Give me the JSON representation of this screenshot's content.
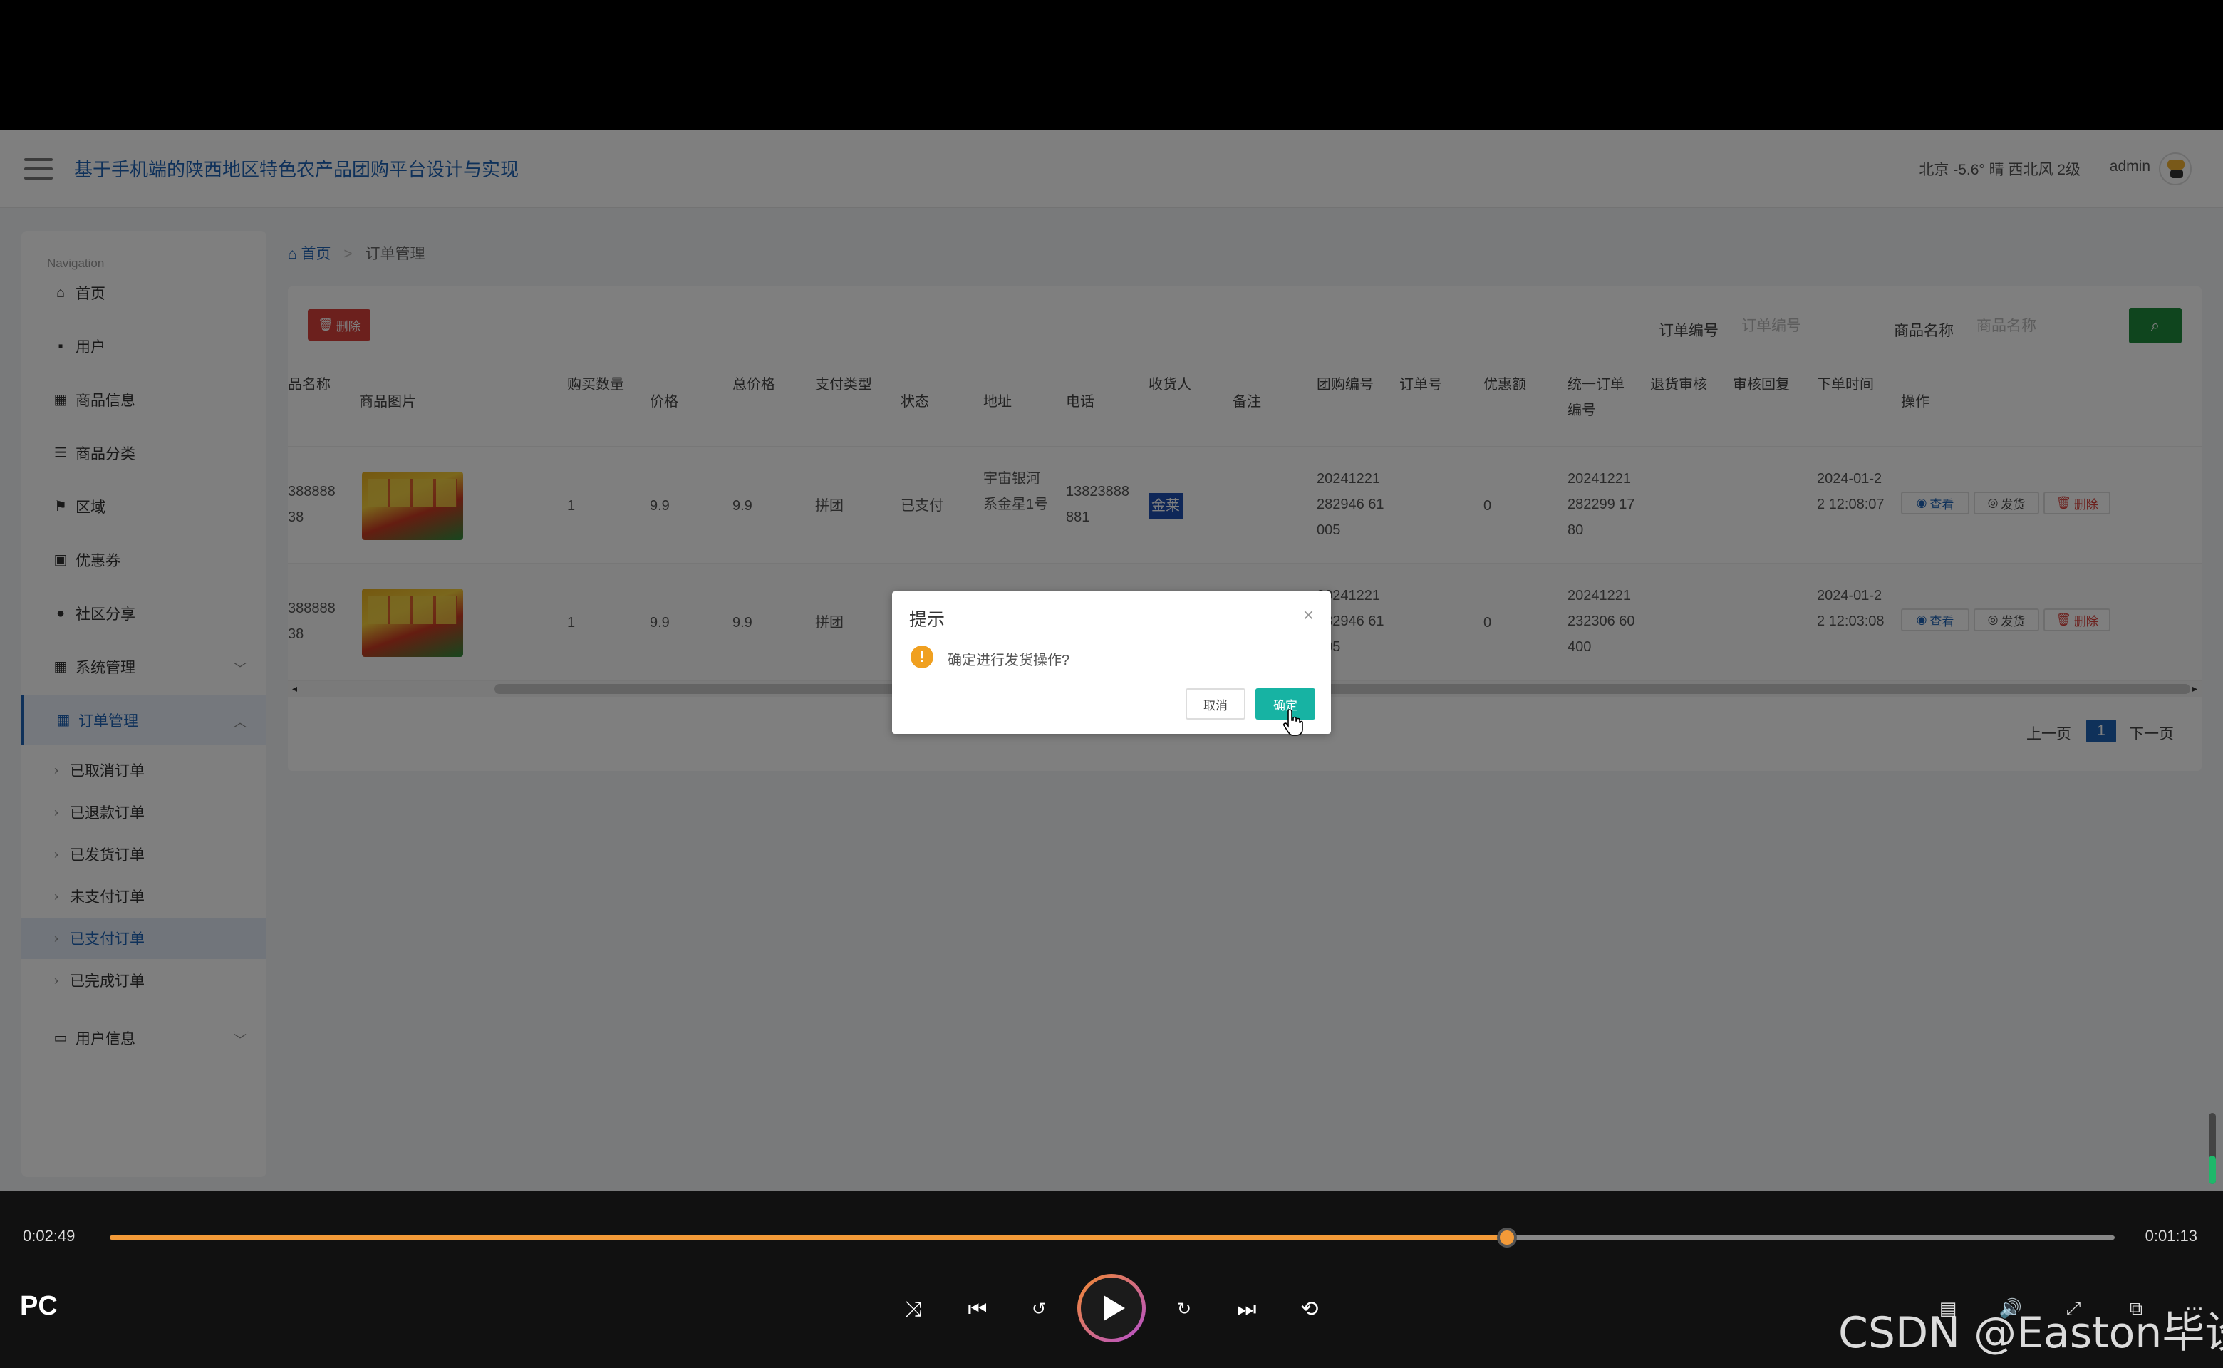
{
  "header": {
    "title": "基于手机端的陕西地区特色农产品团购平台设计与实现",
    "weather": "北京 -5.6° 晴 西北风 2级",
    "user": "admin"
  },
  "sidebar": {
    "nav_label": "Navigation",
    "items": [
      {
        "label": "首页",
        "icon": "home-icon"
      },
      {
        "label": "用户",
        "icon": "user-icon"
      },
      {
        "label": "商品信息",
        "icon": "grid-icon"
      },
      {
        "label": "商品分类",
        "icon": "list-icon"
      },
      {
        "label": "区域",
        "icon": "flag-icon"
      },
      {
        "label": "优惠券",
        "icon": "coupon-icon"
      },
      {
        "label": "社区分享",
        "icon": "share-icon"
      },
      {
        "label": "系统管理",
        "icon": "grid-icon"
      },
      {
        "label": "订单管理",
        "icon": "grid-icon"
      }
    ],
    "order_sub": [
      "已取消订单",
      "已退款订单",
      "已发货订单",
      "未支付订单",
      "已支付订单",
      "已完成订单"
    ],
    "user_info": "用户信息"
  },
  "breadcrumb": {
    "home": "首页",
    "sep": ">",
    "current": "订单管理"
  },
  "toolbar": {
    "delete_label": "删除",
    "order_no_label": "订单编号",
    "order_no_placeholder": "订单编号",
    "product_name_label": "商品名称",
    "product_name_placeholder": "商品名称"
  },
  "table": {
    "headers": {
      "name": "品名称",
      "image": "商品图片",
      "qty": "购买数量",
      "price": "价格",
      "total": "总价格",
      "pay_type": "支付类型",
      "status": "状态",
      "address": "地址",
      "phone": "电话",
      "receiver": "收货人",
      "remark": "备注",
      "group_no": "团购编号",
      "order_id": "订单号",
      "discount": "优惠额",
      "unified_no": "统一订单编号",
      "refund_review": "退货审核",
      "review_reply": "审核回复",
      "order_time": "下单时间",
      "actions": "操作"
    },
    "rows": [
      {
        "name": "388888 38",
        "qty": "1",
        "price": "9.9",
        "total": "9.9",
        "pay_type": "拼团",
        "status": "已支付",
        "address": "宇宙银河系金星1号",
        "phone": "13823888881",
        "receiver": "金莱",
        "group_no": "20241221282946 61005",
        "discount": "0",
        "unified_no": "20241221282299 1780",
        "order_time": "2024-01-22 12:08:07"
      },
      {
        "name": "388888 38",
        "qty": "1",
        "price": "9.9",
        "total": "9.9",
        "pay_type": "拼团",
        "status": "",
        "address": "",
        "phone": "",
        "receiver": "",
        "group_no": "20241221282946 61005",
        "discount": "0",
        "unified_no": "20241221232306 60400",
        "order_time": "2024-01-22 12:03:08"
      }
    ],
    "action_labels": {
      "view": "查看",
      "ship": "发货",
      "delete": "删除"
    }
  },
  "pager": {
    "prev": "上一页",
    "page": "1",
    "next": "下一页"
  },
  "dialog": {
    "title": "提示",
    "message": "确定进行发货操作?",
    "cancel": "取消",
    "ok": "确定"
  },
  "player": {
    "elapsed": "0:02:49",
    "remaining": "0:01:13",
    "progress": 0.697,
    "device": "PC",
    "watermark": "CSDN @Easton毕设"
  },
  "colors": {
    "accent": "#1e63b4",
    "danger": "#d9403a",
    "success": "#1f8a3c",
    "teal": "#17b3a3",
    "progress": "#f39a38"
  }
}
